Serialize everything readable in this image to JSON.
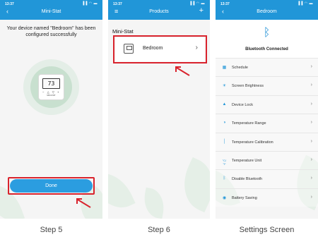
{
  "screens": [
    {
      "status_time": "13:37",
      "status_icons": "▐▐ ◠ ▬",
      "header_title": "Mini-Stat",
      "header_left_icon": "chevron-left-icon",
      "header_left_glyph": "‹",
      "message": "Your device named \"Bedroom\" has been configured successfully",
      "device_display": "73",
      "device_keys": "− △ ▽ +",
      "device_brand": "MINI-STAT",
      "done_label": "Done",
      "caption": "Step 5"
    },
    {
      "status_time": "13:37",
      "status_icons": "▐▐ ◠ ▬",
      "header_title": "Products",
      "header_left_icon": "hamburger-menu-icon",
      "header_left_glyph": "≡",
      "header_right_icon": "plus-icon",
      "header_right_glyph": "+",
      "section_label": "Mini-Stat",
      "device_label": "Bedroom",
      "chevron_glyph": "›",
      "caption": "Step 6"
    },
    {
      "status_time": "13:37",
      "status_icons": "▐▐ ◠ ▬",
      "header_title": "Bedroom",
      "header_left_icon": "chevron-left-icon",
      "header_left_glyph": "‹",
      "bluetooth_glyph": "ᛒ",
      "bluetooth_status": "Bluetooth Connected",
      "menu_items": [
        {
          "label": "Schedule",
          "icon": "calendar-icon",
          "glyph": "▦"
        },
        {
          "label": "Screen Brightness",
          "icon": "sun-icon",
          "glyph": "☀"
        },
        {
          "label": "Device Lock",
          "icon": "lock-icon",
          "glyph": "▲"
        },
        {
          "label": "Temperature Range",
          "icon": "temperature-range-icon",
          "glyph": "◑"
        },
        {
          "label": "Temperature Calibration",
          "icon": "thermometer-icon",
          "glyph": "│"
        },
        {
          "label": "Temperature Unit",
          "icon": "temperature-unit-icon",
          "glyph": "°C/°F"
        },
        {
          "label": "Disable Bluetooth",
          "icon": "bluetooth-off-icon",
          "glyph": "ᛒ"
        },
        {
          "label": "Battery Saving",
          "icon": "battery-saving-icon",
          "glyph": "◉"
        }
      ],
      "chevron_glyph": "›",
      "caption": "Settings Screen"
    }
  ],
  "colors": {
    "header_blue": "#2196d8",
    "button_blue": "#2b9de0",
    "highlight_red": "#d9232d",
    "leaf_green": "#e3eee6"
  }
}
